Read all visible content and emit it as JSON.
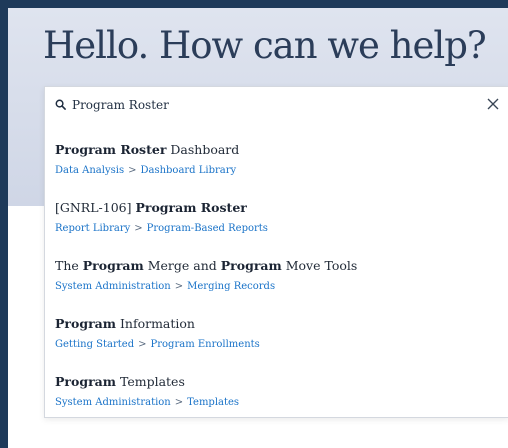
{
  "headline": "Hello. How can we help?",
  "search": {
    "value": "Program Roster"
  },
  "results": [
    {
      "title": [
        {
          "text": "Program Roster",
          "bold": true
        },
        {
          "text": " Dashboard",
          "bold": false
        }
      ],
      "breadcrumb": [
        "Data Analysis",
        "Dashboard Library"
      ]
    },
    {
      "title": [
        {
          "text": "[GNRL-106] ",
          "bold": false
        },
        {
          "text": "Program Roster",
          "bold": true
        }
      ],
      "breadcrumb": [
        "Report Library",
        "Program-Based Reports"
      ]
    },
    {
      "title": [
        {
          "text": "The ",
          "bold": false
        },
        {
          "text": "Program",
          "bold": true
        },
        {
          "text": " Merge and ",
          "bold": false
        },
        {
          "text": "Program",
          "bold": true
        },
        {
          "text": " Move Tools",
          "bold": false
        }
      ],
      "breadcrumb": [
        "System Administration",
        "Merging Records"
      ]
    },
    {
      "title": [
        {
          "text": "Program",
          "bold": true
        },
        {
          "text": " Information",
          "bold": false
        }
      ],
      "breadcrumb": [
        "Getting Started",
        "Program Enrollments"
      ]
    },
    {
      "title": [
        {
          "text": "Program",
          "bold": true
        },
        {
          "text": " Templates",
          "bold": false
        }
      ],
      "breadcrumb": [
        "System Administration",
        "Templates"
      ]
    }
  ],
  "breadcrumb_separator": ">",
  "colors": {
    "frame": "#1e3a5a",
    "heading": "#2b3d59",
    "link": "#1a73c8"
  }
}
